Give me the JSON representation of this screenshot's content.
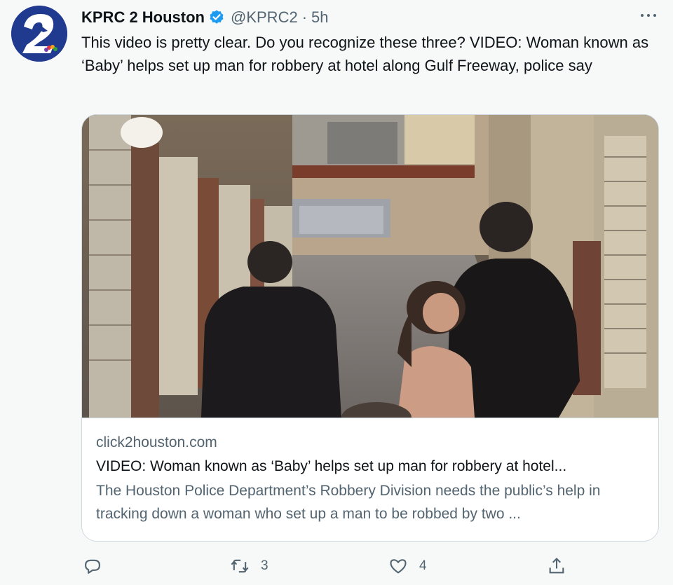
{
  "tweet": {
    "author": {
      "name": "KPRC 2 Houston",
      "handle": "@KPRC2",
      "separator": "·",
      "time": "5h",
      "avatar_logo_text": "2",
      "verified_color": "#1d9bf0"
    },
    "text": "This video is pretty clear. Do you recognize these three?  VIDEO: Woman known as ‘Baby’ helps set up man for robbery at hotel along Gulf Freeway, police say",
    "card": {
      "domain": "click2houston.com",
      "title": "VIDEO: Woman known as ‘Baby’ helps set up man for robbery at hotel...",
      "description": "The Houston Police Department’s Robbery Division needs the public’s help in tracking down a woman who set up a man to be robbed by two ...",
      "image_description": "surveillance-still"
    },
    "actions": {
      "reply_icon": "reply-icon",
      "retweet_icon": "retweet-icon",
      "retweet_count": "3",
      "like_icon": "heart-icon",
      "like_count": "4",
      "share_icon": "share-icon"
    },
    "menu_icon": "more-icon"
  },
  "colors": {
    "background": "#f7f9f9",
    "primary_text": "#0f1419",
    "secondary_text": "#536471",
    "border": "#cfd9de",
    "avatar_bg": "#1f3a8f"
  }
}
